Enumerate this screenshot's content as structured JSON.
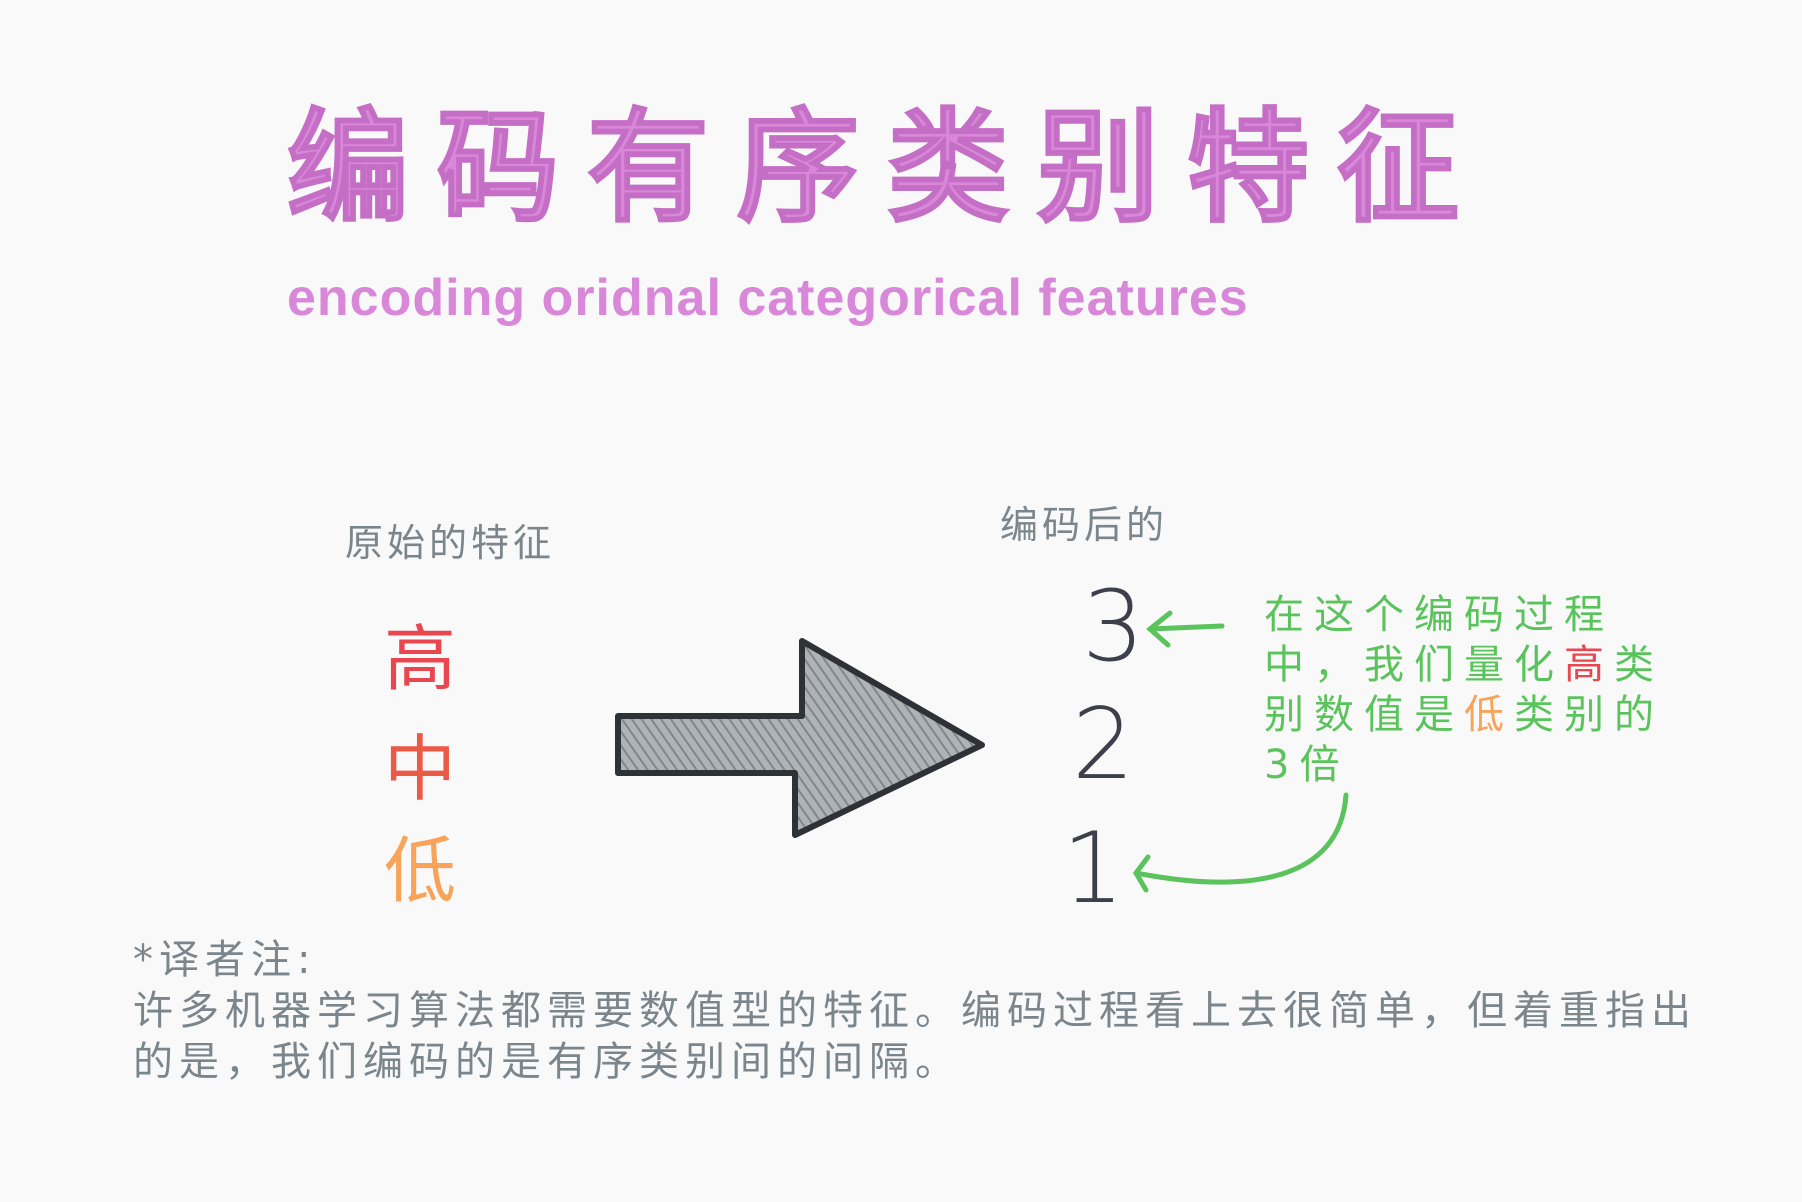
{
  "title": "编码有序类别特征",
  "subtitle": "encoding oridnal categorical features",
  "original": {
    "label": "原始的特征",
    "levels": [
      "高",
      "中",
      "低"
    ]
  },
  "encoded": {
    "label": "编码后的",
    "values": [
      "3",
      "2",
      "1"
    ]
  },
  "explanation": {
    "part1": "在这个编码过程中，我们量化",
    "high": "高",
    "part2": "类别数值是",
    "low": "低",
    "part3": "类别的3倍"
  },
  "note": {
    "heading": "*译者注:",
    "body": "许多机器学习算法都需要数值型的特征。编码过程看上去很简单，但着重指出的是，我们编码的是有序类别间的间隔。"
  },
  "colors": {
    "title": "#d987d9",
    "high": "#e8474f",
    "mid": "#ea5a46",
    "low": "#f7a45a",
    "annotation": "#5ac35c",
    "text": "#7b858c"
  }
}
